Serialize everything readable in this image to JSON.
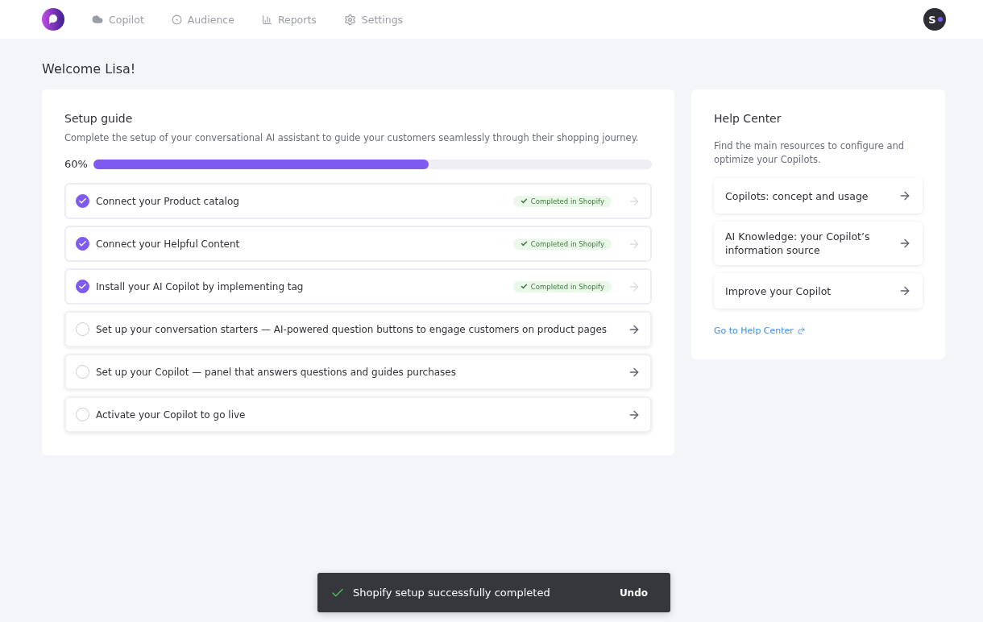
{
  "nav": {
    "items": [
      {
        "label": "Copilot"
      },
      {
        "label": "Audience"
      },
      {
        "label": "Reports"
      },
      {
        "label": "Settings"
      }
    ],
    "avatar": "S"
  },
  "welcome": "Welcome Lisa!",
  "setup_guide": {
    "title": "Setup guide",
    "description": "Complete the setup of your conversational AI assistant to guide your customers seamlessly through their shopping journey.",
    "progress_label": "60%",
    "level": 0.6,
    "steps": [
      {
        "label": "Connect your Product catalog",
        "checked": true,
        "badge": "Completed in Shopify"
      },
      {
        "label": "Connect your Helpful Content",
        "checked": true,
        "badge": "Completed in Shopify"
      },
      {
        "label": "Install your AI Copilot by implementing tag",
        "checked": true,
        "badge": "Completed in Shopify"
      },
      {
        "label": "Set up your conversation starters — AI-powered question buttons to engage customers on product pages",
        "checked": false
      },
      {
        "label": "Set up your Copilot — panel that answers questions and guides purchases",
        "checked": false
      },
      {
        "label": "Activate your Copilot to go live",
        "checked": false
      }
    ]
  },
  "help_center": {
    "title": "Help Center",
    "description": "Find the main resources to configure and optimize your Copilots.",
    "links": [
      "Copilots: concept and usage",
      "AI Knowledge: your Copilot’s information source",
      "Improve your Copilot"
    ],
    "footer_link": "Go to Help Center"
  },
  "toast": {
    "message": "Shopify setup successfully completed",
    "action": "Undo"
  }
}
